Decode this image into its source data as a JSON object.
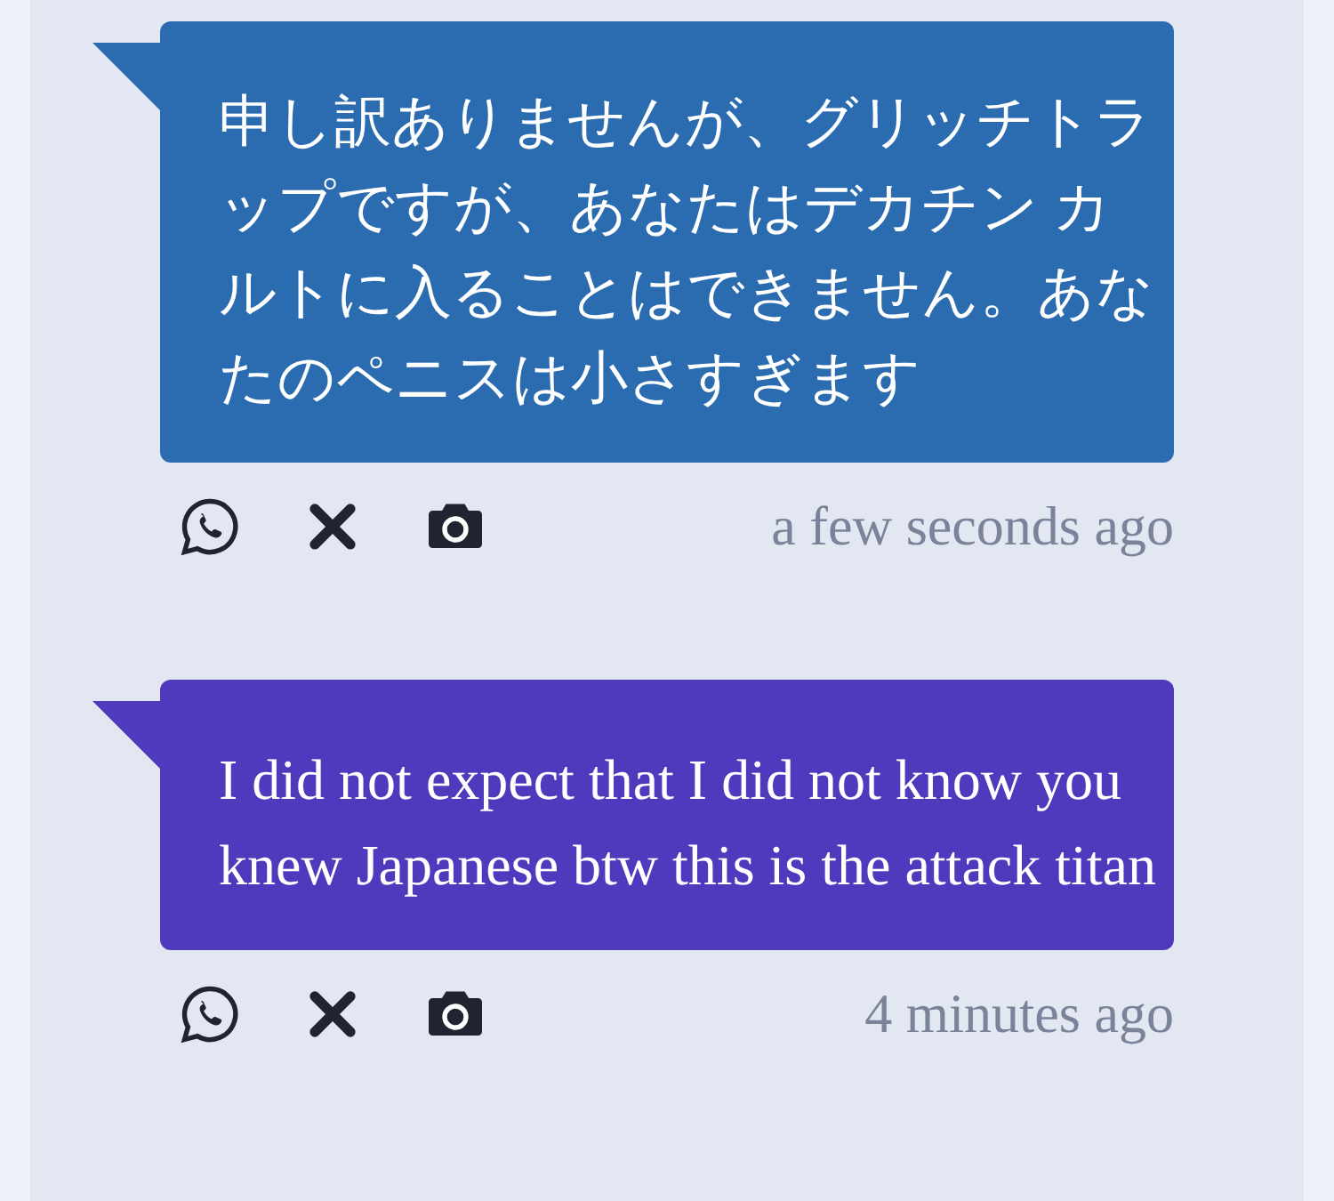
{
  "messages": [
    {
      "text": "申し訳ありませんが、グリッチトラップですが、あなたはデカチン カルトに入ることはできません。あなたのペニスは小さすぎます",
      "color": "#2b6cb0",
      "time": "a few seconds ago"
    },
    {
      "text": "I did not expect that I did not know you knew Japanese btw this is the attack titan",
      "color": "#4f39bd",
      "time": "4 minutes ago"
    }
  ]
}
